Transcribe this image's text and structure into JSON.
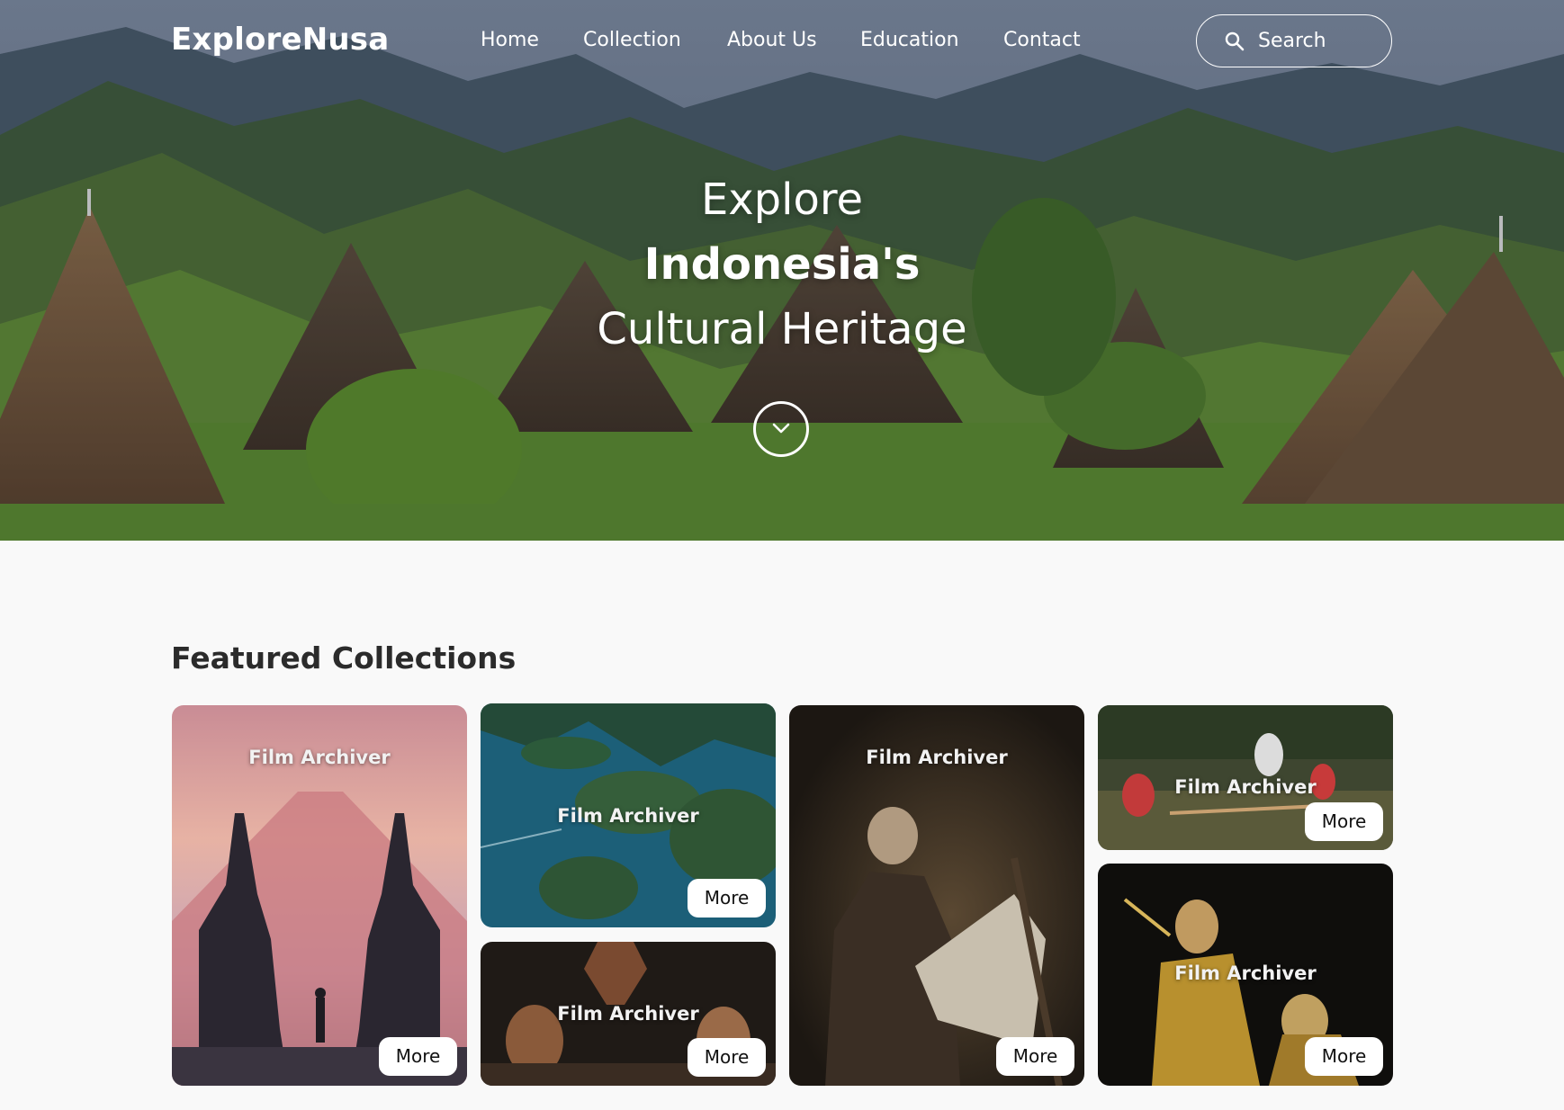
{
  "nav": {
    "brand": "ExploreNusa",
    "links": [
      "Home",
      "Collection",
      "About Us",
      "Education",
      "Contact"
    ],
    "search_placeholder": "Search"
  },
  "hero": {
    "line1": "Explore",
    "line2": "Indonesia's",
    "line3": "Cultural Heritage"
  },
  "featured": {
    "title": "Featured Collections",
    "cards": [
      {
        "label": "Film Archiver",
        "button": "More"
      },
      {
        "label": "Film Archiver",
        "button": "More"
      },
      {
        "label": "Film Archiver",
        "button": "More"
      },
      {
        "label": "Film Archiver",
        "button": "More"
      },
      {
        "label": "Film Archiver",
        "button": "More"
      },
      {
        "label": "Film Archiver",
        "button": "More"
      }
    ]
  },
  "colors": {
    "page_bg": "#f9f9f9",
    "title_text": "#2b2b2b",
    "button_bg": "#ffffff"
  },
  "icons": [
    "search-icon",
    "chevron-down-icon"
  ]
}
